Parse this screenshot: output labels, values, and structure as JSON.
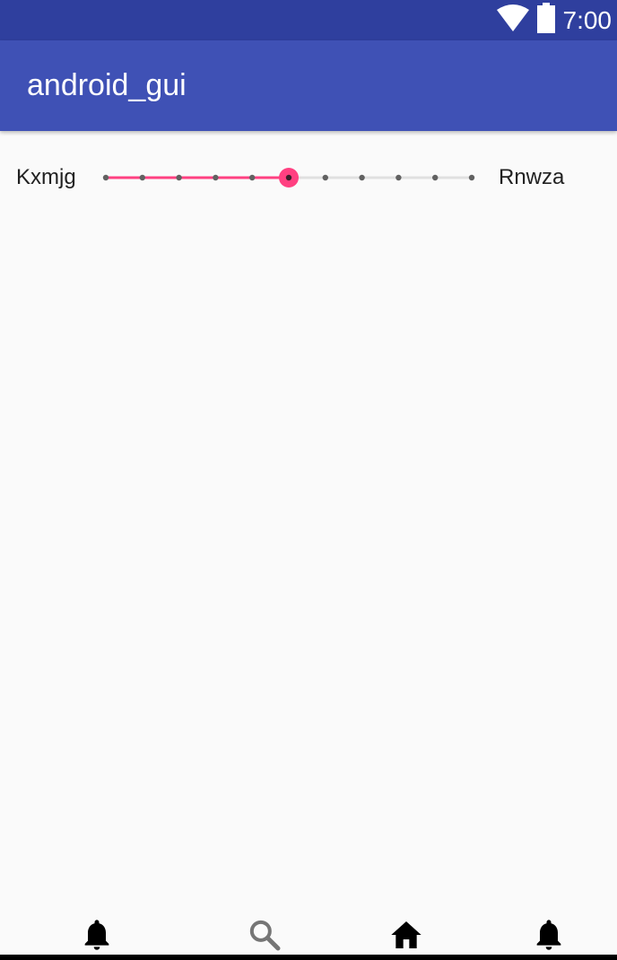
{
  "status_bar": {
    "time": "7:00",
    "background": "#2f3f9e",
    "icons": [
      "wifi-icon",
      "battery-icon"
    ]
  },
  "app_bar": {
    "title": "android_gui",
    "background": "#3f51b5"
  },
  "slider": {
    "min_label": "Kxmjg",
    "max_label": "Rnwza",
    "steps": 10,
    "value": 5,
    "accent": "#ff4081",
    "inactive_track": "#e0e0e0",
    "tick_color": "#616161"
  },
  "bottom_nav": {
    "items": [
      {
        "icon": "bell-icon",
        "color": "#000000"
      },
      {
        "icon": "search-icon",
        "color": "#757575"
      },
      {
        "icon": "home-icon",
        "color": "#000000"
      },
      {
        "icon": "bell-icon",
        "color": "#000000"
      }
    ]
  }
}
